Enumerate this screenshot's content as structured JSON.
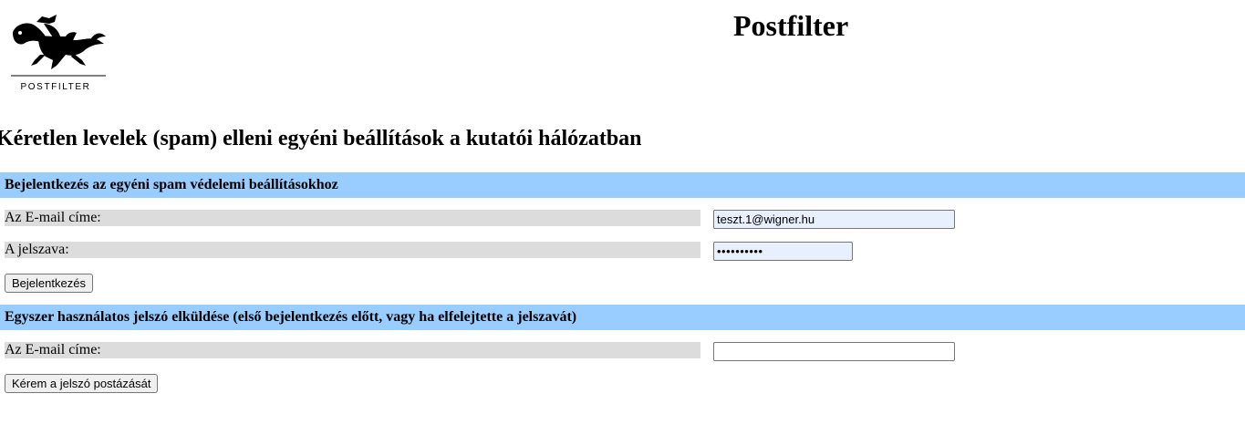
{
  "header": {
    "logo_text": "POSTFILTER",
    "site_title": "Postfilter"
  },
  "page_heading": "Kéretlen levelek (spam) elleni egyéni beállítások a kutatói hálózatban",
  "login_section": {
    "title": "Bejelentkezés az egyéni spam védelemi beállításokhoz",
    "email_label": "Az E-mail címe:",
    "email_value": "teszt.1@wigner.hu",
    "password_label": "A jelszava:",
    "password_value": "••••••••••",
    "submit_label": "Bejelentkezés"
  },
  "otp_section": {
    "title": "Egyszer használatos jelszó elküldése (első bejelentkezés előtt, vagy ha elfelejtette a jelszavát)",
    "email_label": "Az E-mail címe:",
    "email_value": "",
    "submit_label": "Kérem a jelszó postázását"
  },
  "colors": {
    "section_bar": "#99ccff",
    "label_background": "#dcdcdc",
    "autofill_background": "#e8f0fe"
  },
  "icons": {
    "logo": "horse-rider-logo-icon"
  }
}
